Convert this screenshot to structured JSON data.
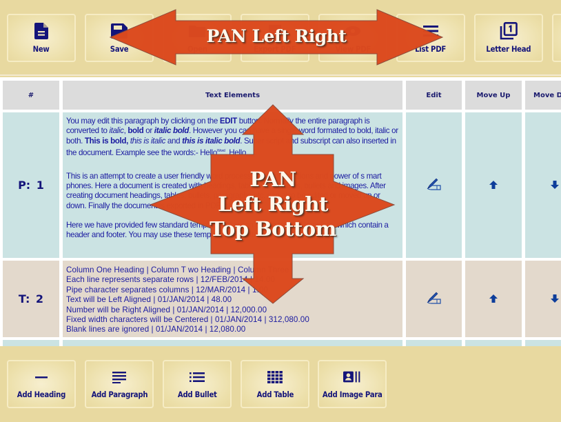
{
  "toolbar": {
    "buttons": [
      {
        "label": "New",
        "icon": "new-document-icon"
      },
      {
        "label": "Save",
        "icon": "save-icon"
      },
      {
        "label": "Open",
        "icon": "open-icon"
      },
      {
        "label": "Export PDF",
        "icon": "export-pdf-icon"
      },
      {
        "label": "View PDF",
        "icon": "view-pdf-icon"
      },
      {
        "label": "List PDF",
        "icon": "list-icon"
      },
      {
        "label": "Letter Head",
        "icon": "letter-head-icon"
      }
    ]
  },
  "table": {
    "headers": [
      "#",
      "Text Elements",
      "Edit",
      "Move Up",
      "Move Down"
    ],
    "rows": [
      {
        "label": "P:  1",
        "type": "paragraph",
        "paragraph1": {
          "t1": "You may edit this paragraph by clicking on the ",
          "b1": "EDIT",
          "t2": " button. Normally the entire paragraph is converted to ",
          "i1": "italic",
          "t3": ", ",
          "b2": "bold",
          "t4": " or ",
          "bi1": "italic bold",
          "t5": ". However you can have a  single word formated to bold, italic or both. ",
          "b3": "This is bold,",
          "t6": " ",
          "i2": "this is italic",
          "t7": " and ",
          "bi2": "this is italic bold",
          "t8": ". Super script and subscript can also inserted in the document. Example see the words:- Hello",
          "sup": "Word",
          "t9": ", Hello",
          "sub": "World",
          "t10": "."
        },
        "paragraph2": "This is an attempt to create a user friendly word processor within limitations and power of s mart phones. Here a document is created with headings, tables, paragraphs, bullets and images. After creating document headings, tables, bullets, paragraphs etc. can also be edited or moved up or down. Finally the document is exported in PDF format.",
        "paragraph3": "Here we have provided few standard templates. You can create tailored template, which contain a header and footer. You may use these templates to create stylish PDF.",
        "edit_icon": "edit-pen-hand-icon",
        "up_icon": "arrow-up-icon",
        "down_icon": "arrow-down-icon"
      },
      {
        "label": "T:  2",
        "type": "table",
        "lines": [
          "Column One Heading | Column T wo Heading | Column Three",
          "Each line represents separate rows | 12/FEB/2014 | 14.00",
          "Pipe character separates columns | 12/MAR/2014 | 1.00",
          "Text will be Left Aligned | 01/JAN/2014 | 48.00",
          "Number will be Right Aligned | 01/JAN/2014 | 12,000.00",
          "Fixed width characters will be Centered | 01/JAN/2014 | 312,080.00",
          "Blank lines are ignored | 01/JAN/2014 | 12,080.00"
        ],
        "edit_icon": "edit-pen-hand-icon",
        "up_icon": "arrow-up-icon",
        "down_icon": "arrow-down-icon"
      }
    ]
  },
  "bottombar": {
    "buttons": [
      {
        "label": "Add Heading",
        "icon": "heading-icon"
      },
      {
        "label": "Add Paragraph",
        "icon": "paragraph-icon"
      },
      {
        "label": "Add Bullet",
        "icon": "bullet-list-icon"
      },
      {
        "label": "Add Table",
        "icon": "table-grid-icon"
      },
      {
        "label": "Add Image Para",
        "icon": "image-para-icon"
      }
    ]
  },
  "overlays": {
    "pan_horizontal": "PAN Left Right",
    "pan_all_line1": "PAN",
    "pan_all_line2": "Left Right",
    "pan_all_line3": "Top Bottom"
  },
  "colors": {
    "toolbar_bg": "#e8d9a0",
    "icon_navy": "#14147a",
    "row_paragraph_bg": "#cbe3e3",
    "row_table_bg": "#e3d9cc",
    "header_bg": "#dcdcdc",
    "overlay_arrow": "#dc4a1e",
    "arrow_blue": "#0d3d9a"
  }
}
